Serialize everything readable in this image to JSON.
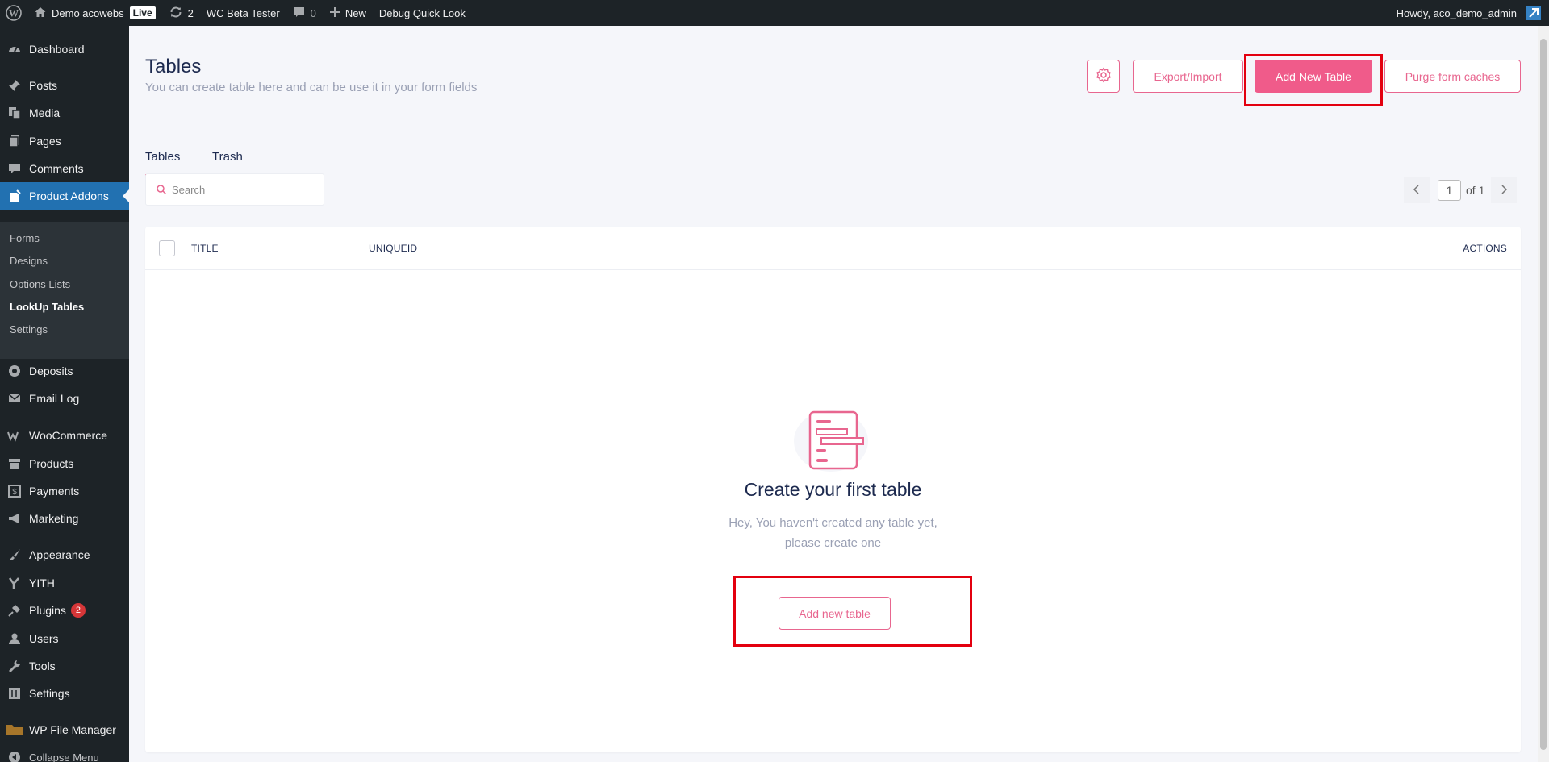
{
  "adminbar": {
    "site_name": "Demo acowebs",
    "live_badge": "Live",
    "updates_count": "2",
    "beta_tester": "WC Beta Tester",
    "comments_count": "0",
    "new_label": "New",
    "debug_label": "Debug Quick Look",
    "howdy": "Howdy, aco_demo_admin"
  },
  "sidebar": {
    "items": [
      {
        "label": "Dashboard",
        "icon": "dashboard-icon"
      },
      {
        "label": "Posts",
        "icon": "pushpin-icon"
      },
      {
        "label": "Media",
        "icon": "media-icon"
      },
      {
        "label": "Pages",
        "icon": "pages-icon"
      },
      {
        "label": "Comments",
        "icon": "comment-icon"
      },
      {
        "label": "Product Addons",
        "icon": "product-addons-icon"
      },
      {
        "label": "Deposits",
        "icon": "deposits-icon"
      },
      {
        "label": "Email Log",
        "icon": "email-icon"
      },
      {
        "label": "WooCommerce",
        "icon": "woocommerce-icon"
      },
      {
        "label": "Products",
        "icon": "archive-icon"
      },
      {
        "label": "Payments",
        "icon": "payments-icon"
      },
      {
        "label": "Marketing",
        "icon": "megaphone-icon"
      },
      {
        "label": "Appearance",
        "icon": "brush-icon"
      },
      {
        "label": "YITH",
        "icon": "yith-icon"
      },
      {
        "label": "Plugins",
        "icon": "plugin-icon",
        "badge": "2"
      },
      {
        "label": "Users",
        "icon": "user-icon"
      },
      {
        "label": "Tools",
        "icon": "wrench-icon"
      },
      {
        "label": "Settings",
        "icon": "settings-icon"
      },
      {
        "label": "WP File Manager",
        "icon": "folder-icon"
      },
      {
        "label": "Collapse Menu",
        "icon": "collapse-icon"
      }
    ],
    "submenu": [
      "Forms",
      "Designs",
      "Options Lists",
      "LookUp Tables",
      "Settings"
    ]
  },
  "header": {
    "title": "Tables",
    "description": "You can create table here and can be use it in your form fields",
    "export_label": "Export/Import",
    "add_label": "Add New Table",
    "purge_label": "Purge form caches"
  },
  "tabs": [
    "Tables",
    "Trash"
  ],
  "search": {
    "placeholder": "Search"
  },
  "pagination": {
    "current": "1",
    "of_label": "of 1"
  },
  "table": {
    "columns": {
      "title": "TITLE",
      "uniqueid": "UNIQUEID",
      "actions": "ACTIONS"
    }
  },
  "empty": {
    "title": "Create your first table",
    "line1": "Hey, You haven't created any table yet,",
    "line2": "please create one",
    "button": "Add new table"
  },
  "colors": {
    "accent": "#f05b8a",
    "sidebar_bg": "#1d2327",
    "sidebar_active": "#2271b1",
    "highlight": "#e3000f"
  }
}
